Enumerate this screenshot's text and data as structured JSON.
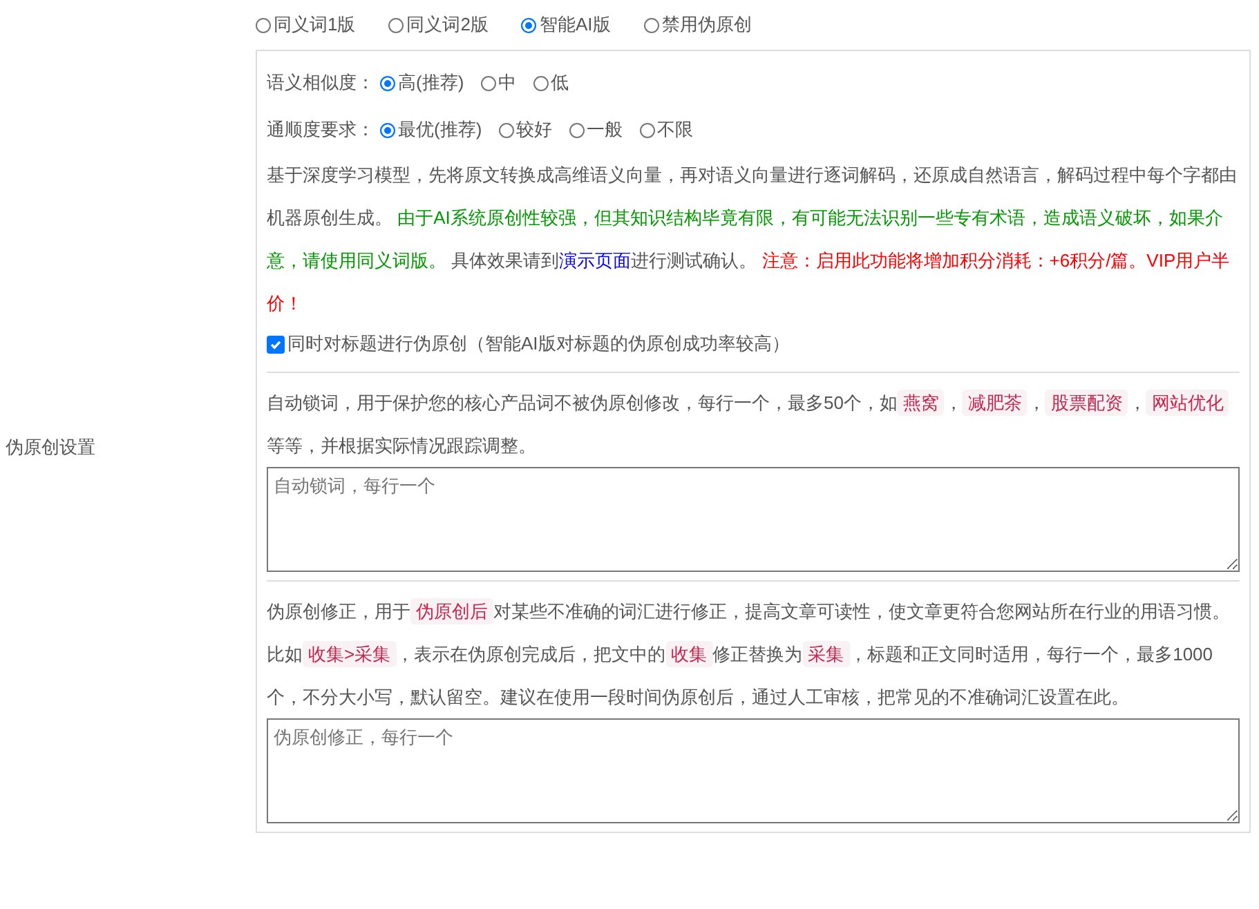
{
  "section_label": "伪原创设置",
  "mode_options": [
    {
      "label": "同义词1版",
      "selected": false
    },
    {
      "label": "同义词2版",
      "selected": false
    },
    {
      "label": "智能AI版",
      "selected": true
    },
    {
      "label": "禁用伪原创",
      "selected": false
    }
  ],
  "settings": [
    {
      "label": "语义相似度：",
      "options": [
        {
          "label": "高(推荐)",
          "selected": true
        },
        {
          "label": "中",
          "selected": false
        },
        {
          "label": "低",
          "selected": false
        }
      ]
    },
    {
      "label": "通顺度要求：",
      "options": [
        {
          "label": "最优(推荐)",
          "selected": true
        },
        {
          "label": "较好",
          "selected": false
        },
        {
          "label": "一般",
          "selected": false
        },
        {
          "label": "不限",
          "selected": false
        }
      ]
    }
  ],
  "ai_description": [
    {
      "kind": "plain",
      "text": "基于深度学习模型，先将原文转换成高维语义向量，再对语义向量进行逐词解码，还原成自然语言，解码过程中每个字都由机器原创生成。 "
    },
    {
      "kind": "green",
      "text": "由于AI系统原创性较强，但其知识结构毕竟有限，有可能无法识别一些专有术语，造成语义破坏，如果介意，请使用同义词版。"
    },
    {
      "kind": "plain",
      "text": " 具体效果请到"
    },
    {
      "kind": "link",
      "text": "演示页面"
    },
    {
      "kind": "plain",
      "text": "进行测试确认。 "
    },
    {
      "kind": "red",
      "text": "注意：启用此功能将增加积分消耗：+6积分/篇。VIP用户半价！"
    }
  ],
  "title_checkbox": {
    "label": "同时对标题进行伪原创（智能AI版对标题的伪原创成功率较高）",
    "checked": true
  },
  "lock_words": {
    "description": [
      {
        "kind": "plain",
        "text": "自动锁词，用于保护您的核心产品词不被伪原创修改，每行一个，最多50个，如"
      },
      {
        "kind": "tag",
        "text": "燕窝"
      },
      {
        "kind": "plain",
        "text": "，"
      },
      {
        "kind": "tag",
        "text": "减肥茶"
      },
      {
        "kind": "plain",
        "text": "，"
      },
      {
        "kind": "tag",
        "text": "股票配资"
      },
      {
        "kind": "plain",
        "text": "，"
      },
      {
        "kind": "tag",
        "text": "网站优化"
      },
      {
        "kind": "plain",
        "text": " 等等，并根据实际情况跟踪调整。"
      }
    ],
    "placeholder": "自动锁词，每行一个"
  },
  "correction": {
    "description": [
      {
        "kind": "plain",
        "text": "伪原创修正，用于"
      },
      {
        "kind": "tag",
        "text": "伪原创后"
      },
      {
        "kind": "plain",
        "text": "对某些不准确的词汇进行修正，提高文章可读性，使文章更符合您网站所在行业的用语习惯。比如"
      },
      {
        "kind": "tag",
        "text": "收集>采集"
      },
      {
        "kind": "plain",
        "text": "，表示在伪原创完成后，把文中的"
      },
      {
        "kind": "tag",
        "text": "收集"
      },
      {
        "kind": "plain",
        "text": "修正替换为"
      },
      {
        "kind": "tag",
        "text": "采集"
      },
      {
        "kind": "plain",
        "text": "，标题和正文同时适用，每行一个，最多1000个，不分大小写，默认留空。建议在使用一段时间伪原创后，通过人工审核，把常见的不准确词汇设置在此。"
      }
    ],
    "placeholder": "伪原创修正，每行一个"
  }
}
